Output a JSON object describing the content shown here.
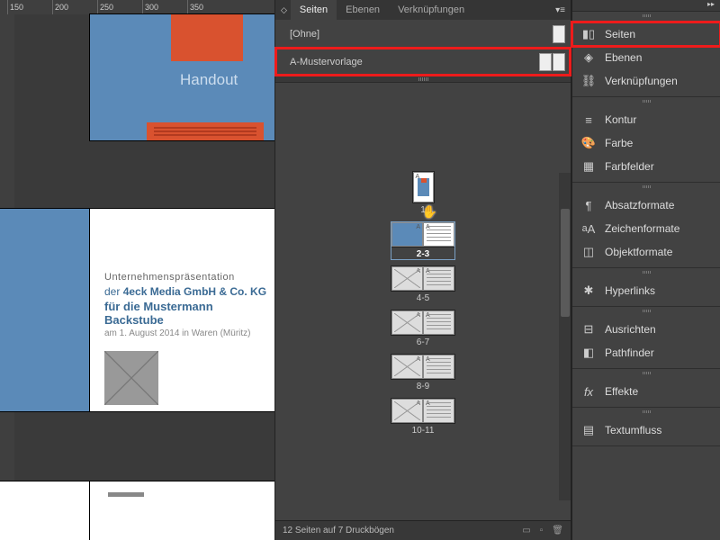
{
  "ruler_marks": [
    "150",
    "200",
    "250",
    "300",
    "350"
  ],
  "canvas": {
    "page1_title": "Handout",
    "page3": {
      "line1": "Unternehmenspräsentation",
      "line2_pre": "der ",
      "line2_bold": "4eck Media GmbH & Co. KG",
      "line3_pre": "für die ",
      "line3_bold": "Mustermann Backstube",
      "line4": "am 1. August 2014 in Waren (Müritz)"
    }
  },
  "mid": {
    "tabs": {
      "seiten": "Seiten",
      "ebenen": "Ebenen",
      "verk": "Verknüpfungen"
    },
    "masters": {
      "none": "[Ohne]",
      "a": "A-Mustervorlage"
    },
    "labels": {
      "s1": "1",
      "s2": "2-3",
      "s3": "4-5",
      "s4": "6-7",
      "s5": "8-9",
      "s6": "10-11"
    },
    "footer": "12 Seiten auf 7 Druckbögen"
  },
  "dock": {
    "seiten": "Seiten",
    "ebenen": "Ebenen",
    "verk": "Verknüpfungen",
    "kontur": "Kontur",
    "farbe": "Farbe",
    "farbfelder": "Farbfelder",
    "absatz": "Absatzformate",
    "zeichen": "Zeichenformate",
    "objekt": "Objektformate",
    "hyperlinks": "Hyperlinks",
    "ausrichten": "Ausrichten",
    "pathfinder": "Pathfinder",
    "effekte": "Effekte",
    "textumfluss": "Textumfluss"
  }
}
